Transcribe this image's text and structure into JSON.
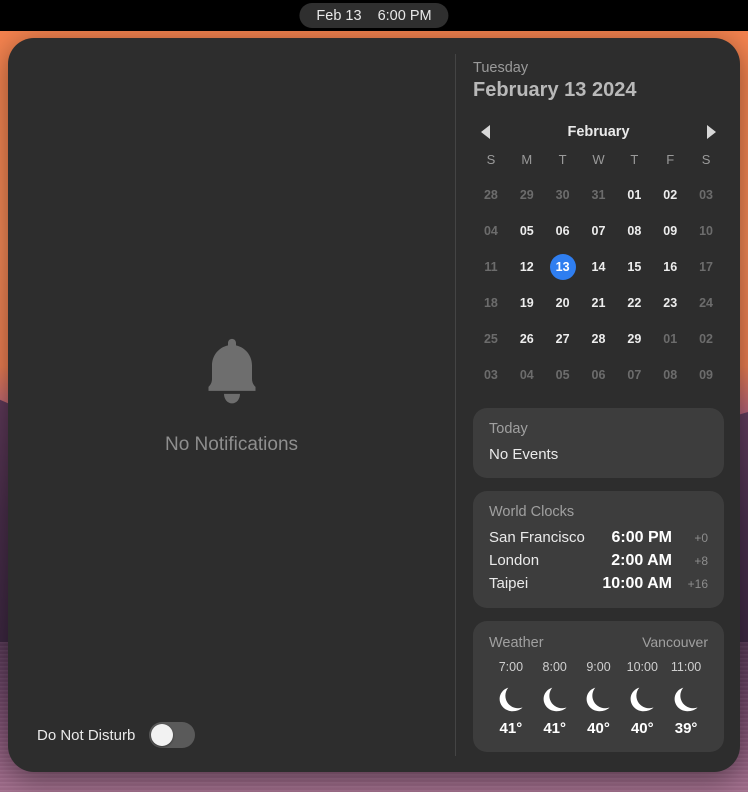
{
  "menubar": {
    "date": "Feb 13",
    "time": "6:00 PM"
  },
  "notifications": {
    "icon": "bell-icon",
    "empty_text": "No Notifications",
    "dnd_label": "Do Not Disturb",
    "dnd_state": "off"
  },
  "header": {
    "weekday": "Tuesday",
    "date": "February 13 2024"
  },
  "calendar": {
    "month_label": "February",
    "prev_icon": "chevron-left-icon",
    "next_icon": "chevron-right-icon",
    "weekdays": [
      "S",
      "M",
      "T",
      "W",
      "T",
      "F",
      "S"
    ],
    "selected_day": "13",
    "accent_color": "#2f7ef0",
    "weeks": [
      [
        {
          "label": "28",
          "muted": true
        },
        {
          "label": "29",
          "muted": true
        },
        {
          "label": "30",
          "muted": true
        },
        {
          "label": "31",
          "muted": true
        },
        {
          "label": "01",
          "muted": false
        },
        {
          "label": "02",
          "muted": false
        },
        {
          "label": "03",
          "muted": true
        }
      ],
      [
        {
          "label": "04",
          "muted": true
        },
        {
          "label": "05",
          "muted": false
        },
        {
          "label": "06",
          "muted": false
        },
        {
          "label": "07",
          "muted": false
        },
        {
          "label": "08",
          "muted": false
        },
        {
          "label": "09",
          "muted": false
        },
        {
          "label": "10",
          "muted": true
        }
      ],
      [
        {
          "label": "11",
          "muted": true
        },
        {
          "label": "12",
          "muted": false
        },
        {
          "label": "13",
          "muted": false,
          "today": true
        },
        {
          "label": "14",
          "muted": false
        },
        {
          "label": "15",
          "muted": false
        },
        {
          "label": "16",
          "muted": false
        },
        {
          "label": "17",
          "muted": true
        }
      ],
      [
        {
          "label": "18",
          "muted": true
        },
        {
          "label": "19",
          "muted": false
        },
        {
          "label": "20",
          "muted": false
        },
        {
          "label": "21",
          "muted": false
        },
        {
          "label": "22",
          "muted": false
        },
        {
          "label": "23",
          "muted": false
        },
        {
          "label": "24",
          "muted": true
        }
      ],
      [
        {
          "label": "25",
          "muted": true
        },
        {
          "label": "26",
          "muted": false
        },
        {
          "label": "27",
          "muted": false
        },
        {
          "label": "28",
          "muted": false
        },
        {
          "label": "29",
          "muted": false
        },
        {
          "label": "01",
          "muted": true
        },
        {
          "label": "02",
          "muted": true
        }
      ],
      [
        {
          "label": "03",
          "muted": true
        },
        {
          "label": "04",
          "muted": true
        },
        {
          "label": "05",
          "muted": true
        },
        {
          "label": "06",
          "muted": true
        },
        {
          "label": "07",
          "muted": true
        },
        {
          "label": "08",
          "muted": true
        },
        {
          "label": "09",
          "muted": true
        }
      ]
    ]
  },
  "events_widget": {
    "title": "Today",
    "body": "No Events"
  },
  "world_clocks": {
    "title": "World Clocks",
    "rows": [
      {
        "city": "San Francisco",
        "time": "6:00 PM",
        "offset": "+0"
      },
      {
        "city": "London",
        "time": "2:00 AM",
        "offset": "+8"
      },
      {
        "city": "Taipei",
        "time": "10:00 AM",
        "offset": "+16"
      }
    ]
  },
  "weather": {
    "title": "Weather",
    "location": "Vancouver",
    "hours": [
      {
        "time": "7:00",
        "icon": "moon-icon",
        "temp": "41°"
      },
      {
        "time": "8:00",
        "icon": "moon-icon",
        "temp": "41°"
      },
      {
        "time": "9:00",
        "icon": "moon-icon",
        "temp": "40°"
      },
      {
        "time": "10:00",
        "icon": "moon-icon",
        "temp": "40°"
      },
      {
        "time": "11:00",
        "icon": "moon-icon",
        "temp": "39°"
      }
    ]
  }
}
